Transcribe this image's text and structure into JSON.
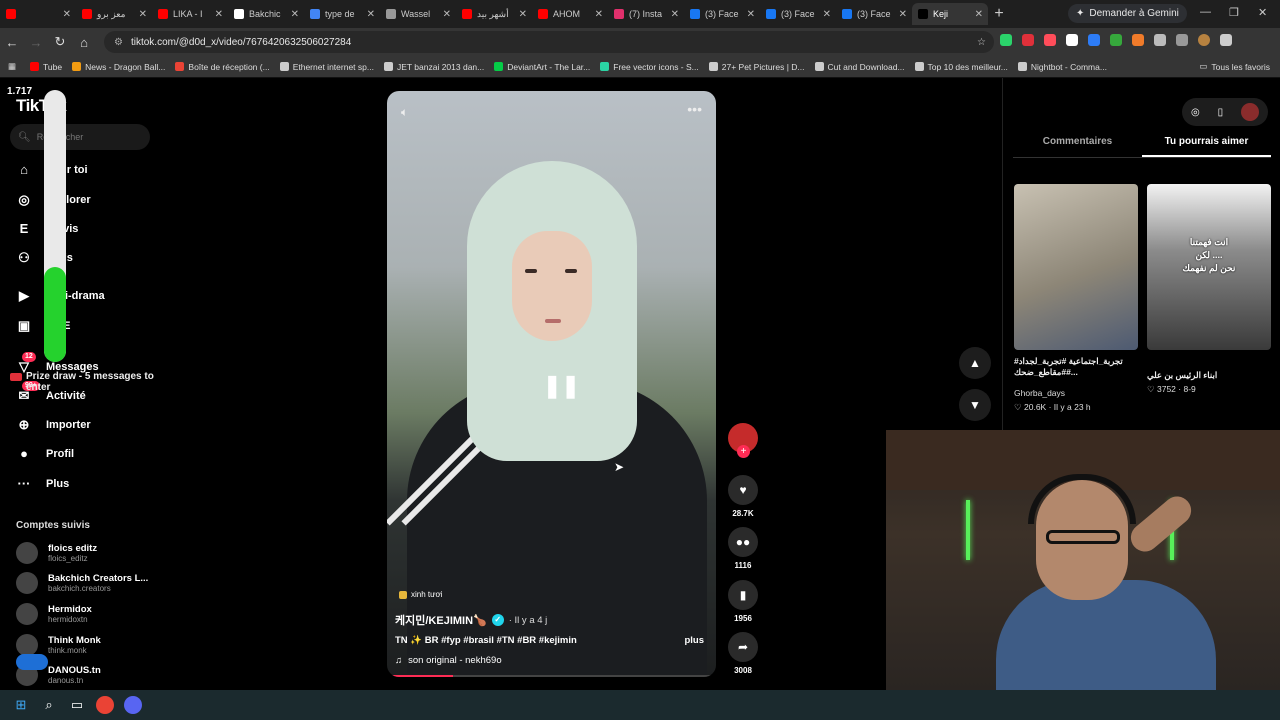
{
  "browser": {
    "tabs": [
      {
        "label": "",
        "color": "#ff0000"
      },
      {
        "label": "معز برو",
        "color": "#ff0000"
      },
      {
        "label": "LIKA - I",
        "color": "#ff0000"
      },
      {
        "label": "Bakchic",
        "color": "#ffffff"
      },
      {
        "label": "type de",
        "color": "#4285f4"
      },
      {
        "label": "Wassel",
        "color": "#999999"
      },
      {
        "label": "أشهر بيد",
        "color": "#ff0000"
      },
      {
        "label": "AHOM",
        "color": "#ff0000"
      },
      {
        "label": "(7) Insta",
        "color": "#e1306c"
      },
      {
        "label": "(3) Face",
        "color": "#1877f2"
      },
      {
        "label": "(3) Face",
        "color": "#1877f2"
      },
      {
        "label": "(3) Face",
        "color": "#1877f2"
      },
      {
        "label": "Keji",
        "color": "#000000"
      }
    ],
    "gemini_label": "Demander à Gemini",
    "url": "tiktok.com/@d0d_x/video/7676420632506027284",
    "bookmarks": [
      "Tube",
      "News - Dragon Ball...",
      "Boîte de réception (...",
      "Ethernet internet sp...",
      "JET banzai 2013 dan...",
      "DeviantArt - The Lar...",
      "Free vector icons - S...",
      "27+ Pet Pictures | D...",
      "Cut and Download...",
      "Top 10 des meilleur...",
      "Nightbot - Comma..."
    ],
    "bookmarks_all": "Tous les favoris"
  },
  "overlay": {
    "viewers": "1.717",
    "prize_text": "Prize draw - 5 messages to enter",
    "level_fraction": 0.35
  },
  "sidebar": {
    "logo": "TikTok",
    "search_placeholder": "Rechercher",
    "nav": [
      {
        "label": "Pour toi",
        "icon": "home-icon"
      },
      {
        "label": "Explorer",
        "icon": "compass-icon"
      },
      {
        "label": "Suivis",
        "icon": "following-icon"
      },
      {
        "label": "Amis",
        "icon": "friends-icon"
      },
      {
        "label": "Mini-drama",
        "icon": "drama-icon"
      },
      {
        "label": "LIVE",
        "icon": "live-icon"
      },
      {
        "label": "Messages",
        "icon": "messages-icon",
        "badge": "12"
      },
      {
        "label": "Activité",
        "icon": "activity-icon",
        "badge": "99+"
      },
      {
        "label": "Importer",
        "icon": "upload-icon"
      },
      {
        "label": "Profil",
        "icon": "profile-icon"
      },
      {
        "label": "Plus",
        "icon": "more-icon"
      }
    ],
    "follows_title": "Comptes suivis",
    "follows": [
      {
        "name": "floics editz",
        "user": "floics_editz"
      },
      {
        "name": "Bakchich Creators L...",
        "user": "bakchich.creators"
      },
      {
        "name": "Hermidox",
        "user": "hermidoxtn"
      },
      {
        "name": "Think Monk",
        "user": "think.monk"
      },
      {
        "name": "DANOUS.tn",
        "user": "danous.tn"
      }
    ]
  },
  "video": {
    "tag": "xinh tươi",
    "author": "케지민/KEJIMIN🍗",
    "time": "· Il y a 4 j",
    "hashtags": "TN ✨ BR #fyp #brasil #TN #BR #kejimin",
    "more": "plus",
    "sound": "son original - nekh69o",
    "progress_fraction": 0.2
  },
  "actions": {
    "likes": "28.7K",
    "comments": "1116",
    "saves": "1956",
    "shares": "3008"
  },
  "rightpanel": {
    "tabs": [
      "Commentaires",
      "Tu pourrais aimer"
    ],
    "cards": [
      {
        "caption": "#تجربة_اجتماعية #تجربة_لجداد #مقاطع_ضحك#...",
        "author": "Ghorba_days",
        "likes": "20.6K",
        "time": "Il y a 23 h",
        "overlay": ""
      },
      {
        "caption": "ابناء الرئيس بن علي",
        "author": "",
        "likes": "3752",
        "time": "8-9",
        "overlay": "انت فهمتنا\nلكن ....\nنحن لم نفهمك"
      }
    ]
  }
}
